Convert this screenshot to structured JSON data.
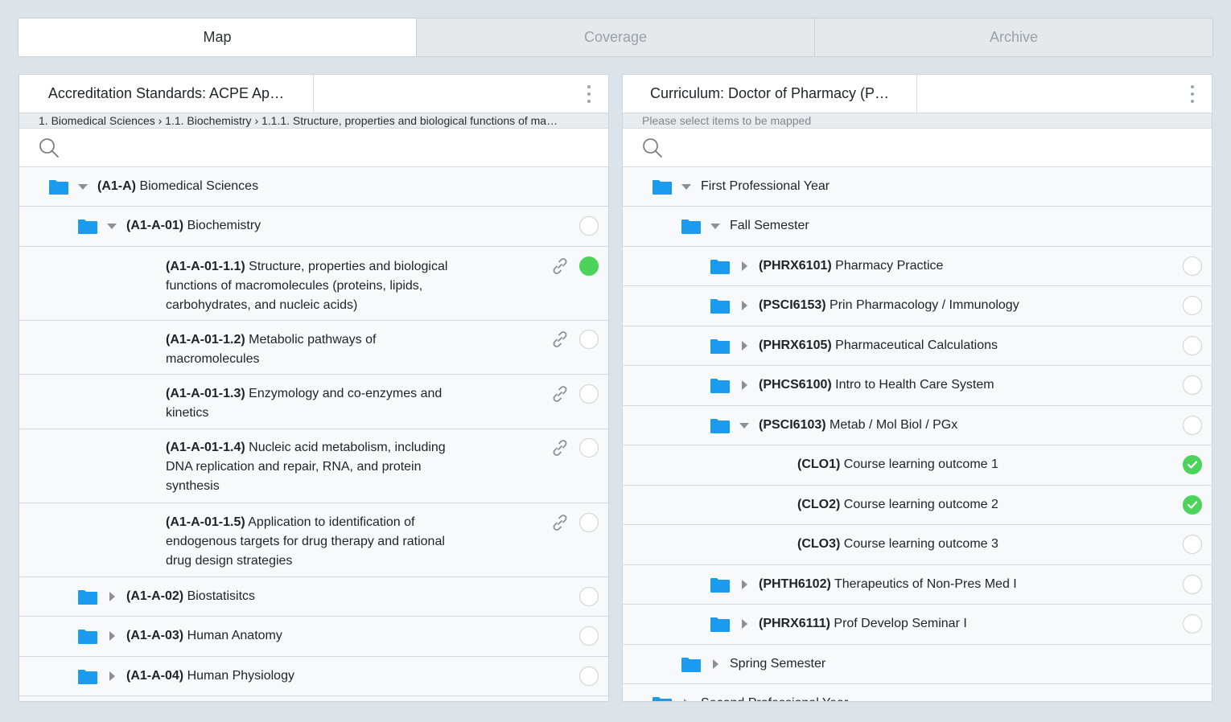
{
  "tabs": [
    {
      "label": "Map",
      "active": true
    },
    {
      "label": "Coverage",
      "active": false
    },
    {
      "label": "Archive",
      "active": false
    }
  ],
  "left": {
    "title": "Accreditation Standards: ACPE Ap…",
    "breadcrumb": "1. Biomedical Sciences › 1.1. Biochemistry › 1.1.1. Structure, properties and biological functions of ma…",
    "rows": [
      {
        "code": "(A1-A)",
        "text": "Biomedical Sciences",
        "level": 0
      },
      {
        "code": "(A1-A-01)",
        "text": "Biochemistry",
        "level": 1
      },
      {
        "code": "(A1-A-01-1.1)",
        "line1": "Structure, properties and biological",
        "line2": "functions of macromolecules (proteins, lipids,",
        "line3": "carbohydrates, and nucleic acids)"
      },
      {
        "code": "(A1-A-01-1.2)",
        "line1": "Metabolic pathways of",
        "line2": "macromolecules"
      },
      {
        "code": "(A1-A-01-1.3)",
        "line1": "Enzymology and co-enzymes and",
        "line2": "kinetics"
      },
      {
        "code": "(A1-A-01-1.4)",
        "line1": "Nucleic acid metabolism, including",
        "line2": "DNA replication and repair, RNA, and protein",
        "line3": "synthesis"
      },
      {
        "code": "(A1-A-01-1.5)",
        "line1": "Application to identification of",
        "line2": "endogenous targets for drug therapy and rational",
        "line3": "drug design strategies"
      },
      {
        "code": "(A1-A-02)",
        "text": "Biostatisitcs"
      },
      {
        "code": "(A1-A-03)",
        "text": "Human Anatomy"
      },
      {
        "code": "(A1-A-04)",
        "text": "Human Physiology"
      }
    ]
  },
  "right": {
    "title": "Curriculum: Doctor of Pharmacy (P…",
    "breadcrumb": "Please select items to be mapped",
    "rows": [
      {
        "text": "First Professional Year"
      },
      {
        "text": "Fall Semester"
      },
      {
        "code": "(PHRX6101)",
        "text": "Pharmacy Practice"
      },
      {
        "code": "(PSCI6153)",
        "text": "Prin Pharmacology / Immunology"
      },
      {
        "code": "(PHRX6105)",
        "text": "Pharmaceutical Calculations"
      },
      {
        "code": "(PHCS6100)",
        "text": "Intro to Health Care System"
      },
      {
        "code": "(PSCI6103)",
        "text": "Metab / Mol Biol / PGx"
      },
      {
        "code": "(CLO1)",
        "text": "Course learning outcome 1"
      },
      {
        "code": "(CLO2)",
        "text": "Course learning outcome 2"
      },
      {
        "code": "(CLO3)",
        "text": "Course learning outcome 3"
      },
      {
        "code": "(PHTH6102)",
        "text": "Therapeutics of Non-Pres Med I"
      },
      {
        "code": "(PHRX6111)",
        "text": "Prof Develop Seminar I"
      },
      {
        "text": "Spring Semester"
      },
      {
        "text": "Second Professional Year"
      }
    ]
  },
  "colors": {
    "folder": "#1a9bf0",
    "selected": "#4cd35a"
  }
}
